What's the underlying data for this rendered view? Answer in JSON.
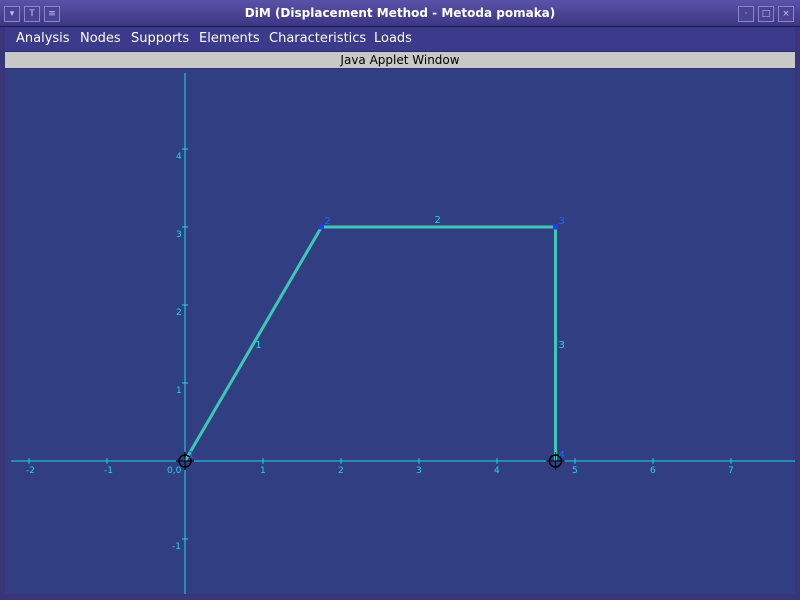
{
  "window": {
    "title": "DiM (Displacement Method - Metoda pomaka)"
  },
  "menu": {
    "items": [
      "Analysis",
      "Nodes",
      "Supports",
      "Elements",
      "Characteristics",
      "Loads"
    ]
  },
  "applet_label": "Java Applet Window",
  "colors": {
    "canvas_bg": "#323e82",
    "axis": "#19d9e6",
    "element": "#3cc8b4",
    "node_label": "#1e64ff"
  },
  "x_ticks": [
    "-2",
    "-1",
    "0,0",
    "1",
    "2",
    "3",
    "4",
    "5",
    "6",
    "7"
  ],
  "y_ticks": [
    "4",
    "3",
    "2",
    "1",
    "-1"
  ],
  "nodes": [
    {
      "id": "1",
      "x": 0,
      "y": 0,
      "support": "pinned"
    },
    {
      "id": "2",
      "x": 1.75,
      "y": 3,
      "support": "none"
    },
    {
      "id": "3",
      "x": 4.75,
      "y": 3,
      "support": "none"
    },
    {
      "id": "4",
      "x": 4.75,
      "y": 0,
      "support": "pinned"
    }
  ],
  "elements": [
    {
      "id": "1",
      "from": 1,
      "to": 2
    },
    {
      "id": "2",
      "from": 2,
      "to": 3
    },
    {
      "id": "3",
      "from": 3,
      "to": 4
    }
  ]
}
